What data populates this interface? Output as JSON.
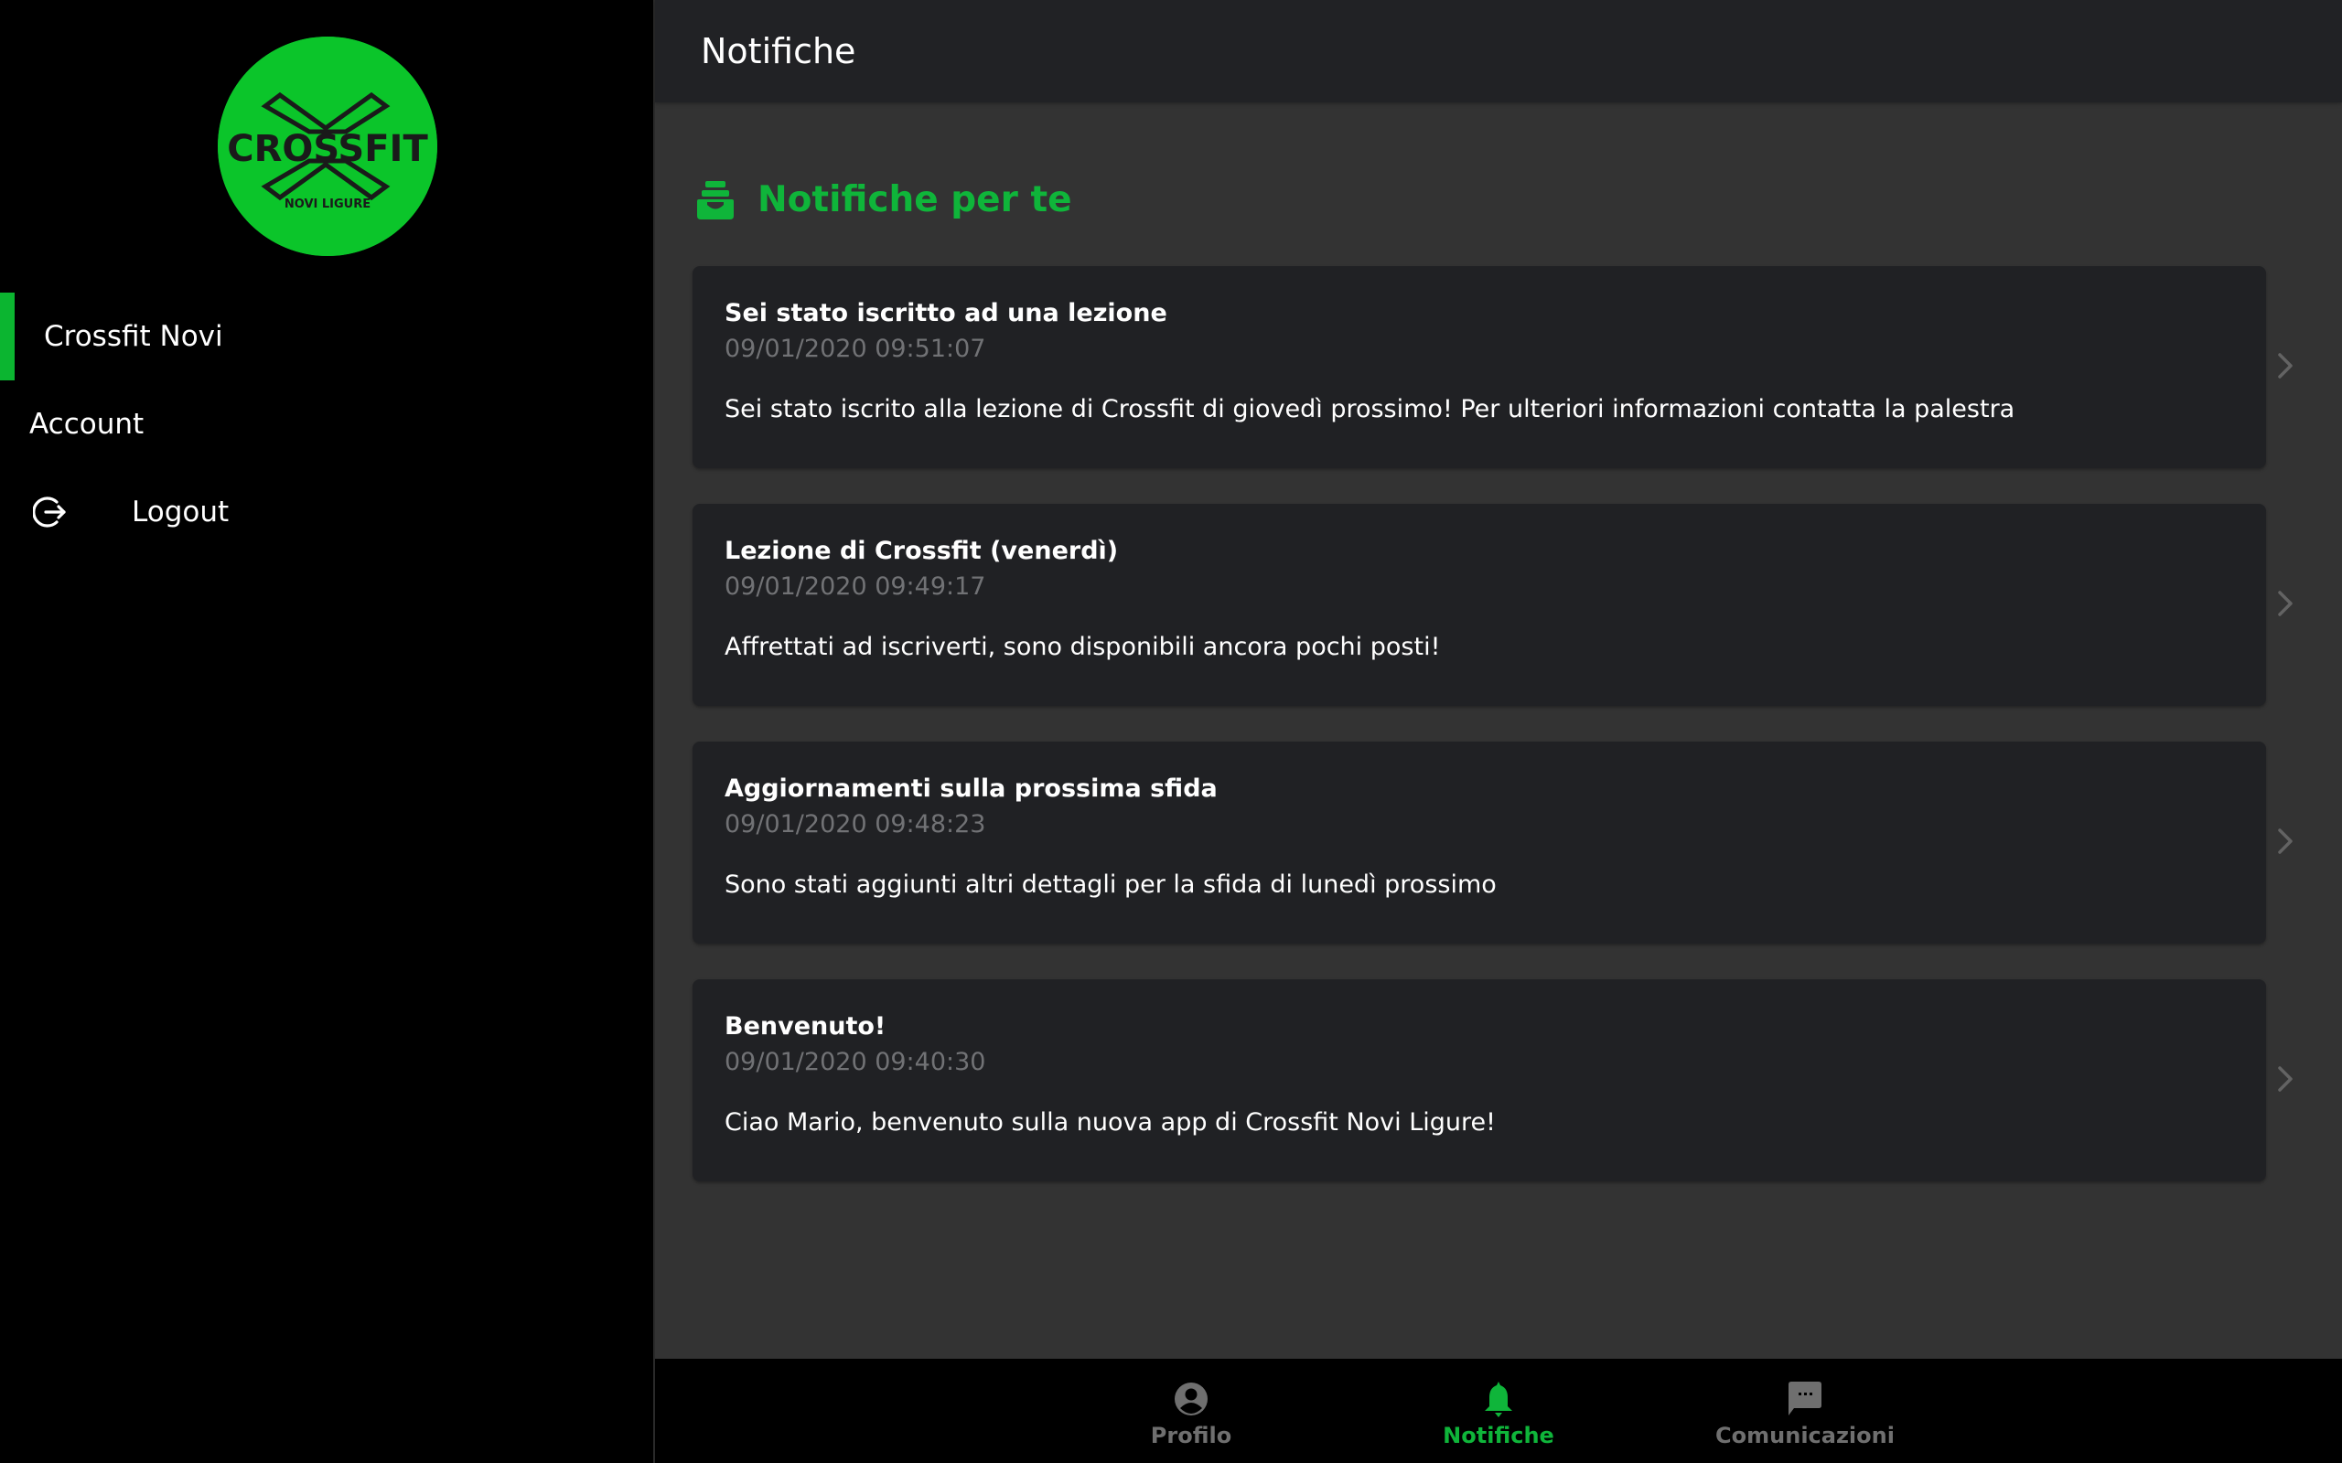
{
  "brand": {
    "logo_text": "CROSSFIT",
    "logo_subtext": "NOVI LIGURE",
    "accent_color": "#0bc52a"
  },
  "sidebar": {
    "items": [
      {
        "label": "Crossfit Novi",
        "active": true
      },
      {
        "label": "Account",
        "active": false
      },
      {
        "label": "Logout",
        "icon": "logout-icon",
        "active": false
      }
    ]
  },
  "header": {
    "title": "Notifiche"
  },
  "section": {
    "title": "Notifiche per te",
    "icon": "file-tray-icon"
  },
  "notifications": [
    {
      "title": "Sei stato iscritto ad una lezione",
      "timestamp": "09/01/2020 09:51:07",
      "body": "Sei stato iscrito alla lezione di Crossfit di giovedì prossimo! Per ulteriori informazioni contatta la palestra"
    },
    {
      "title": "Lezione di Crossfit (venerdì)",
      "timestamp": "09/01/2020 09:49:17",
      "body": "Affrettati ad iscriverti, sono disponibili ancora pochi posti!"
    },
    {
      "title": "Aggiornamenti sulla prossima sfida",
      "timestamp": "09/01/2020 09:48:23",
      "body": "Sono stati aggiunti altri dettagli per la sfida di lunedì prossimo"
    },
    {
      "title": "Benvenuto!",
      "timestamp": "09/01/2020 09:40:30",
      "body": "Ciao Mario, benvenuto sulla nuova app di Crossfit Novi Ligure!"
    }
  ],
  "tabs": [
    {
      "label": "Profilo",
      "icon": "person-circle-icon",
      "active": false
    },
    {
      "label": "Notifiche",
      "icon": "bell-icon",
      "active": true
    },
    {
      "label": "Comunicazioni",
      "icon": "chat-bubble-icon",
      "active": false
    }
  ]
}
